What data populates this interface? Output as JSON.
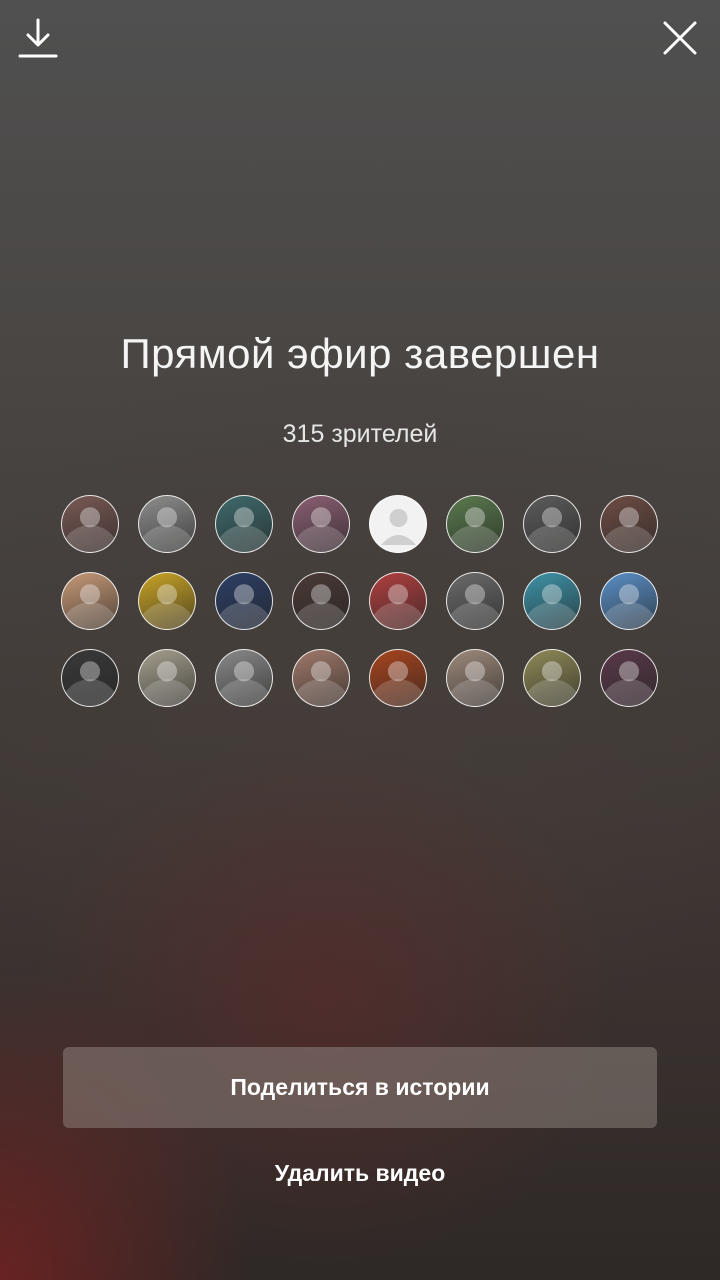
{
  "top_bar": {
    "download_icon": "download-icon",
    "close_icon": "close-icon"
  },
  "title": "Прямой эфир завершен",
  "viewers_count": "315 зрителей",
  "viewers": [
    {
      "icon": "viewer-avatar",
      "color": "#7a5a55"
    },
    {
      "icon": "viewer-avatar",
      "color": "#8e8e8e"
    },
    {
      "icon": "viewer-avatar",
      "color": "#3f6a6c"
    },
    {
      "icon": "viewer-avatar",
      "color": "#8a5f73"
    },
    {
      "icon": "default-user-icon",
      "color": "#f2f2f2"
    },
    {
      "icon": "viewer-avatar",
      "color": "#5a7a4e"
    },
    {
      "icon": "viewer-avatar",
      "color": "#5c5c5c"
    },
    {
      "icon": "viewer-avatar",
      "color": "#6e4d45"
    },
    {
      "icon": "viewer-avatar",
      "color": "#c79a78"
    },
    {
      "icon": "viewer-avatar",
      "color": "#c9a426"
    },
    {
      "icon": "viewer-avatar",
      "color": "#2d3f66"
    },
    {
      "icon": "viewer-avatar",
      "color": "#4a3a36"
    },
    {
      "icon": "viewer-avatar",
      "color": "#b04040"
    },
    {
      "icon": "viewer-avatar",
      "color": "#6b6b6b"
    },
    {
      "icon": "viewer-avatar",
      "color": "#3e93a8"
    },
    {
      "icon": "viewer-avatar",
      "color": "#5a8fc6"
    },
    {
      "icon": "viewer-avatar",
      "color": "#3a3a3a"
    },
    {
      "icon": "viewer-avatar",
      "color": "#a6a08f"
    },
    {
      "icon": "viewer-avatar",
      "color": "#8a8a8a"
    },
    {
      "icon": "viewer-avatar",
      "color": "#a07a6a"
    },
    {
      "icon": "viewer-avatar",
      "color": "#a8451f"
    },
    {
      "icon": "viewer-avatar",
      "color": "#9e8a7c"
    },
    {
      "icon": "viewer-avatar",
      "color": "#8f8a58"
    },
    {
      "icon": "viewer-avatar",
      "color": "#5a3a4a"
    }
  ],
  "share_button": "Поделиться в истории",
  "delete_button": "Удалить видео"
}
